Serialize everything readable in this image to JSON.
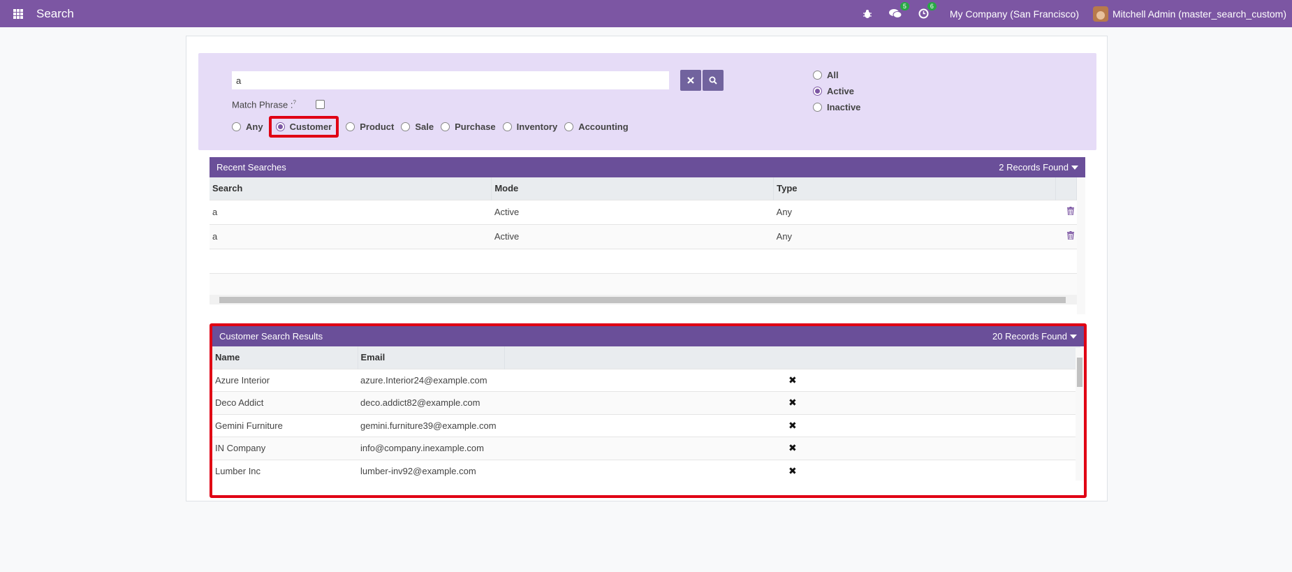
{
  "topbar": {
    "title": "Search",
    "messages_badge": "5",
    "activities_badge": "6",
    "company": "My Company (San Francisco)",
    "user": "Mitchell Admin (master_search_custom)"
  },
  "search": {
    "query": "a",
    "match_phrase_label": "Match Phrase :",
    "match_phrase_hint": "?",
    "types": [
      "Any",
      "Customer",
      "Product",
      "Sale",
      "Purchase",
      "Inventory",
      "Accounting"
    ],
    "selected_type": "Customer",
    "status_options": [
      "All",
      "Active",
      "Inactive"
    ],
    "selected_status": "Active"
  },
  "recent": {
    "title": "Recent Searches",
    "count": "2 Records Found",
    "columns": [
      "Search",
      "Mode",
      "Type"
    ],
    "rows": [
      {
        "search": "a",
        "mode": "Active",
        "type": "Any"
      },
      {
        "search": "a",
        "mode": "Active",
        "type": "Any"
      }
    ]
  },
  "results": {
    "title": "Customer Search Results",
    "count": "20 Records Found",
    "columns": [
      "Name",
      "Email"
    ],
    "rows": [
      {
        "name": "Azure Interior",
        "email": "azure.Interior24@example.com"
      },
      {
        "name": "Deco Addict",
        "email": "deco.addict82@example.com"
      },
      {
        "name": "Gemini Furniture",
        "email": "gemini.furniture39@example.com"
      },
      {
        "name": "IN Company",
        "email": "info@company.inexample.com"
      },
      {
        "name": "Lumber Inc",
        "email": "lumber-inv92@example.com"
      }
    ]
  }
}
